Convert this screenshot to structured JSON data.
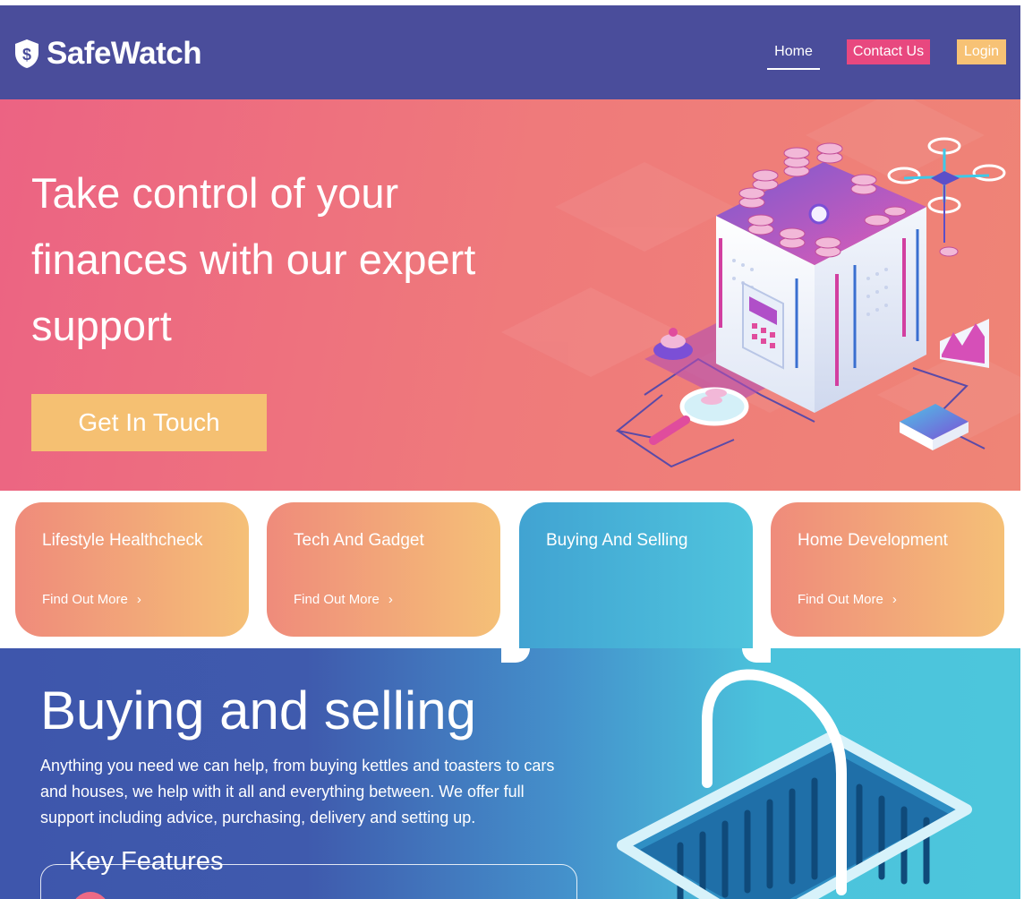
{
  "header": {
    "brand_name": "SafeWatch",
    "nav": {
      "home": "Home",
      "contact": "Contact Us",
      "login": "Login"
    }
  },
  "hero": {
    "title": "Take control of your finances with our expert support",
    "cta": "Get In Touch"
  },
  "cards": [
    {
      "title": "Lifestyle Healthcheck",
      "link": "Find Out More"
    },
    {
      "title": "Tech And Gadget",
      "link": "Find Out More"
    },
    {
      "title": "Buying And Selling",
      "link": ""
    },
    {
      "title": "Home Development",
      "link": "Find Out More"
    }
  ],
  "section": {
    "title": "Buying and selling",
    "text": "Anything you need we can help, from buying kettles and toasters to cars and houses, we help with it all and everything between. We offer full support including advice, purchasing, delivery and setting up.",
    "features_title": "Key Features"
  },
  "icons": {
    "logo": "shield-dollar-icon",
    "chevron": "chevron-right-icon"
  },
  "colors": {
    "header": "#4a4d9b",
    "contact_button": "#e8487f",
    "login_button": "#f7c275",
    "cta": "#f5c072",
    "card_gradient_start": "#ef8b7b",
    "card_gradient_end": "#f5c077",
    "active_card": "#41a3d2",
    "section_start": "#3e56ac",
    "section_end": "#4cc6dc"
  }
}
